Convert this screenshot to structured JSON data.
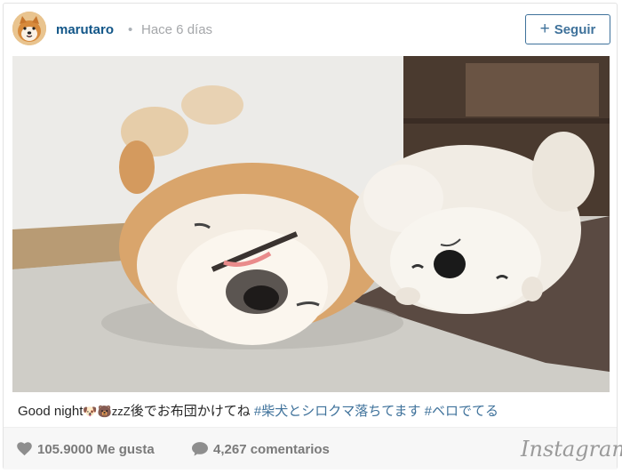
{
  "post": {
    "username": "marutaro",
    "separator": "•",
    "time_ago": "Hace 6 días",
    "follow_label": "Seguir",
    "follow_plus": "+"
  },
  "caption": {
    "text_start": "Good night",
    "emoji_1": "🐶🐻",
    "zzz": "zzZ",
    "text_mid": "後でお布団かけてね ",
    "hashtag_1": "#柴犬とシロクマ落ちてます",
    "space": " ",
    "hashtag_2": "#ベロでてる"
  },
  "stats": {
    "likes": "105.9000 Me gusta",
    "comments": "4,267 comentarios"
  },
  "brand": {
    "logo_text": "Instagram"
  },
  "colors": {
    "username": "#125688",
    "follow": "#3f729b",
    "hashtag": "#3f729b",
    "meta_gray": "#a5a7aa"
  },
  "icons": {
    "like": "heart-icon",
    "comment": "speech-bubble-icon"
  }
}
